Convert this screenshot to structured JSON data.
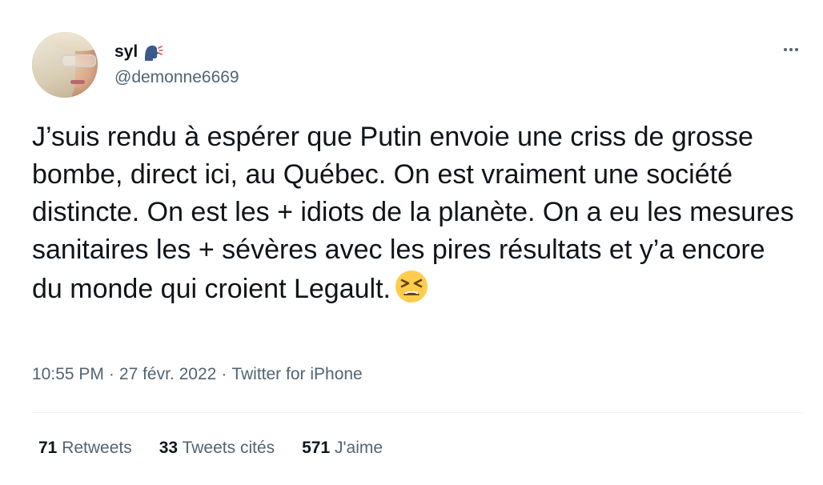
{
  "author": {
    "display_name": "syl",
    "handle": "@demonne6669",
    "badge_icon": "speaking-head-icon"
  },
  "tweet": {
    "text": "J’suis rendu à espérer que Putin envoie une criss de grosse bombe, direct ici, au Québec. On est vraiment une société distincte. On est les + idiots de la planète. On a eu les mesures sanitaires les + sévères avec les pires résultats et y’a encore du monde qui croient Legault.",
    "emoji": "tired-face-emoji"
  },
  "meta": {
    "time": "10:55 PM",
    "separator": "·",
    "date": "27 févr. 2022",
    "source": "Twitter for iPhone"
  },
  "stats": {
    "retweets_count": "71",
    "retweets_label": "Retweets",
    "quotes_count": "33",
    "quotes_label": "Tweets cités",
    "likes_count": "571",
    "likes_label": "J'aime"
  },
  "colors": {
    "text": "#0f1419",
    "secondary": "#536471",
    "divider": "#eff3f4"
  }
}
